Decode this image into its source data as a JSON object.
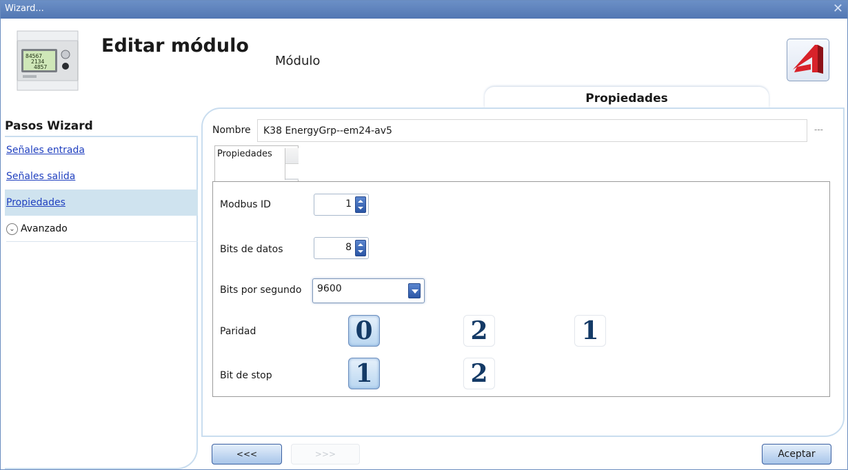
{
  "window": {
    "title": "Wizard...",
    "close_glyph": "✕"
  },
  "header": {
    "title": "Editar módulo",
    "subtitle": "Módulo",
    "module_image": "energy-meter-module-icon",
    "logo": "brand-logo-icon",
    "section_tab": "Propiedades"
  },
  "sidebar": {
    "title": "Pasos Wizard",
    "items": [
      {
        "label": "Señales entrada",
        "link": true
      },
      {
        "label": "Señales salida",
        "link": true
      },
      {
        "label": "Propiedades",
        "link": true,
        "active": true
      },
      {
        "label": "Avanzado",
        "link": false,
        "icon": "chevron-down-circle-icon"
      }
    ]
  },
  "form": {
    "name_label": "Nombre",
    "name_value": "K38 EnergyGrp--em24-av5",
    "name_extra": "---",
    "inner_tab": "Propiedades",
    "modbus_id_label": "Modbus ID",
    "modbus_id_value": "1",
    "data_bits_label": "Bits de datos",
    "data_bits_value": "8",
    "baud_label": "Bits por segundo",
    "baud_value": "9600",
    "parity_label": "Paridad",
    "parity_options": [
      "0",
      "2",
      "1"
    ],
    "parity_selected": "0",
    "stop_label": "Bit de stop",
    "stop_options": [
      "1",
      "2"
    ],
    "stop_selected": "1"
  },
  "footer": {
    "back_label": "<<<",
    "next_label": ">>>",
    "accept_label": "Aceptar"
  },
  "colors": {
    "titlebar": "#5e83be",
    "link": "#1f3fbf",
    "active_step_bg": "#cfe3ef",
    "panel_border": "#c9ddef",
    "accent_button": "#2b56a5"
  }
}
